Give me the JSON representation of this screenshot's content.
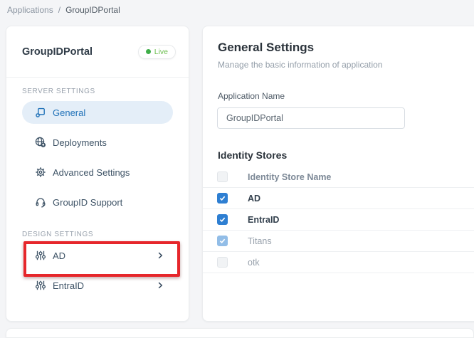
{
  "breadcrumb": {
    "items": [
      "Applications",
      "GroupIDPortal"
    ],
    "separator": "/"
  },
  "sidebar": {
    "app_title": "GroupIDPortal",
    "live_badge": {
      "label": "Live",
      "dot_color": "#3fae49",
      "text_color": "#6dbf50"
    },
    "server_section_label": "SERVER SETTINGS",
    "design_section_label": "DESIGN SETTINGS",
    "server_items": [
      {
        "label": "General",
        "icon": "app-window-gear-icon",
        "active": true
      },
      {
        "label": "Deployments",
        "icon": "globe-deploy-icon",
        "active": false
      },
      {
        "label": "Advanced Settings",
        "icon": "gear-icon",
        "active": false
      },
      {
        "label": "GroupID Support",
        "icon": "headset-icon",
        "active": false
      }
    ],
    "design_items": [
      {
        "label": "AD",
        "icon": "sliders-icon",
        "highlighted_by_annotation": true
      },
      {
        "label": "EntraID",
        "icon": "sliders-icon",
        "highlighted_by_annotation": false
      }
    ]
  },
  "main": {
    "title": "General Settings",
    "subtitle": "Manage the basic information of application",
    "form": {
      "application_name_label": "Application Name",
      "application_name_value": "GroupIDPortal"
    },
    "identity_stores": {
      "title": "Identity Stores",
      "columns": [
        "Identity Store Name"
      ],
      "rows": [
        {
          "name": "AD",
          "checked": true,
          "enabled": true
        },
        {
          "name": "EntraID",
          "checked": true,
          "enabled": true
        },
        {
          "name": "Titans",
          "checked": true,
          "enabled": false
        },
        {
          "name": "otk",
          "checked": false,
          "enabled": true
        }
      ]
    }
  },
  "colors": {
    "accent_blue": "#2273b9",
    "active_item_bg": "#e4eef8",
    "checkbox_blue": "#2e7fd2",
    "checkbox_disabled_blue": "#92bde7",
    "annotation_red": "#e6262b",
    "live_green": "#3fae49",
    "page_bg": "#f4f5f7"
  }
}
